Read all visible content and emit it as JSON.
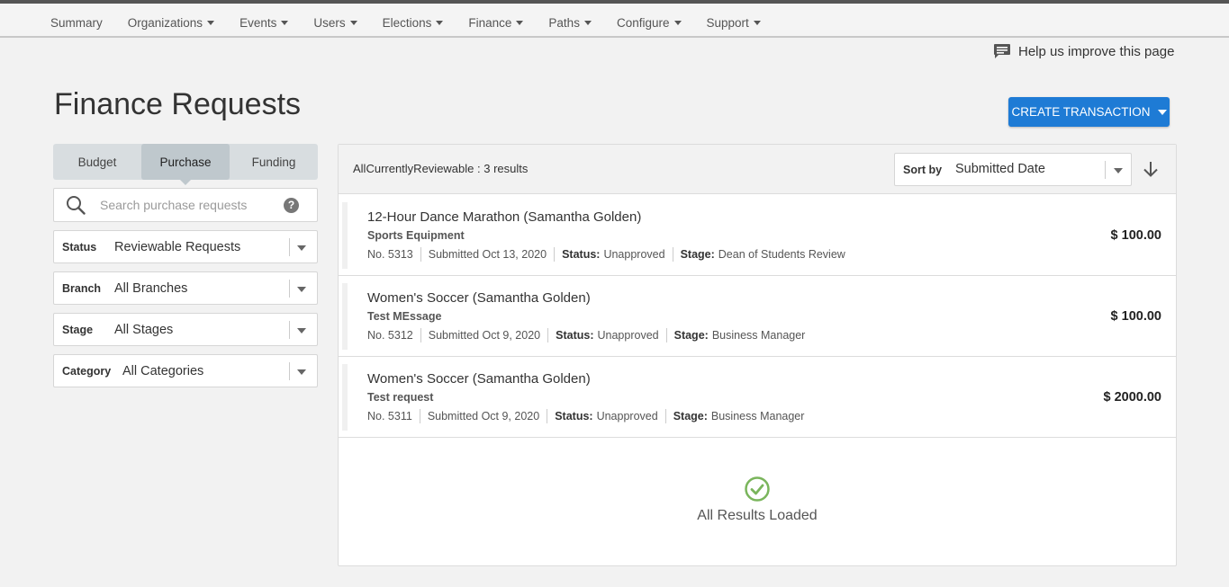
{
  "nav": {
    "items": [
      {
        "label": "Summary",
        "dropdown": false
      },
      {
        "label": "Organizations",
        "dropdown": true
      },
      {
        "label": "Events",
        "dropdown": true
      },
      {
        "label": "Users",
        "dropdown": true
      },
      {
        "label": "Elections",
        "dropdown": true
      },
      {
        "label": "Finance",
        "dropdown": true
      },
      {
        "label": "Paths",
        "dropdown": true
      },
      {
        "label": "Configure",
        "dropdown": true
      },
      {
        "label": "Support",
        "dropdown": true
      }
    ]
  },
  "help": {
    "label": "Help us improve this page",
    "icon": "comment-icon"
  },
  "page": {
    "title": "Finance Requests"
  },
  "create_button": {
    "label": "CREATE TRANSACTION"
  },
  "tabs": [
    {
      "label": "Budget",
      "active": false
    },
    {
      "label": "Purchase",
      "active": true
    },
    {
      "label": "Funding",
      "active": false
    }
  ],
  "search": {
    "placeholder": "Search purchase requests",
    "value": "",
    "help": "?"
  },
  "filters": {
    "status": {
      "label": "Status",
      "value": "Reviewable Requests"
    },
    "branch": {
      "label": "Branch",
      "value": "All Branches"
    },
    "stage": {
      "label": "Stage",
      "value": "All Stages"
    },
    "category": {
      "label": "Category",
      "value": "All Categories"
    }
  },
  "results": {
    "summary": "AllCurrentlyReviewable : 3 results",
    "sort_label": "Sort by",
    "sort_value": "Submitted Date",
    "sort_direction": "descending"
  },
  "requests": [
    {
      "title": "12-Hour Dance Marathon (Samantha Golden)",
      "subtitle": "Sports Equipment",
      "number": "No. 5313",
      "submitted": "Submitted Oct 13, 2020",
      "status_label": "Status:",
      "status": "Unapproved",
      "stage_label": "Stage:",
      "stage": "Dean of Students Review",
      "amount": "$ 100.00"
    },
    {
      "title": "Women's Soccer (Samantha Golden)",
      "subtitle": "Test MEssage",
      "number": "No. 5312",
      "submitted": "Submitted Oct 9, 2020",
      "status_label": "Status:",
      "status": "Unapproved",
      "stage_label": "Stage:",
      "stage": "Business Manager",
      "amount": "$ 100.00"
    },
    {
      "title": "Women's Soccer (Samantha Golden)",
      "subtitle": "Test request",
      "number": "No. 5311",
      "submitted": "Submitted Oct 9, 2020",
      "status_label": "Status:",
      "status": "Unapproved",
      "stage_label": "Stage:",
      "stage": "Business Manager",
      "amount": "$ 2000.00"
    }
  ],
  "footer": {
    "loaded_label": "All Results Loaded",
    "icon": "check-circle-icon"
  },
  "colors": {
    "primary": "#1e7bd5",
    "success": "#7ab55c",
    "tab_active": "#bfc8cd",
    "tab_bg": "#d8dde0"
  }
}
